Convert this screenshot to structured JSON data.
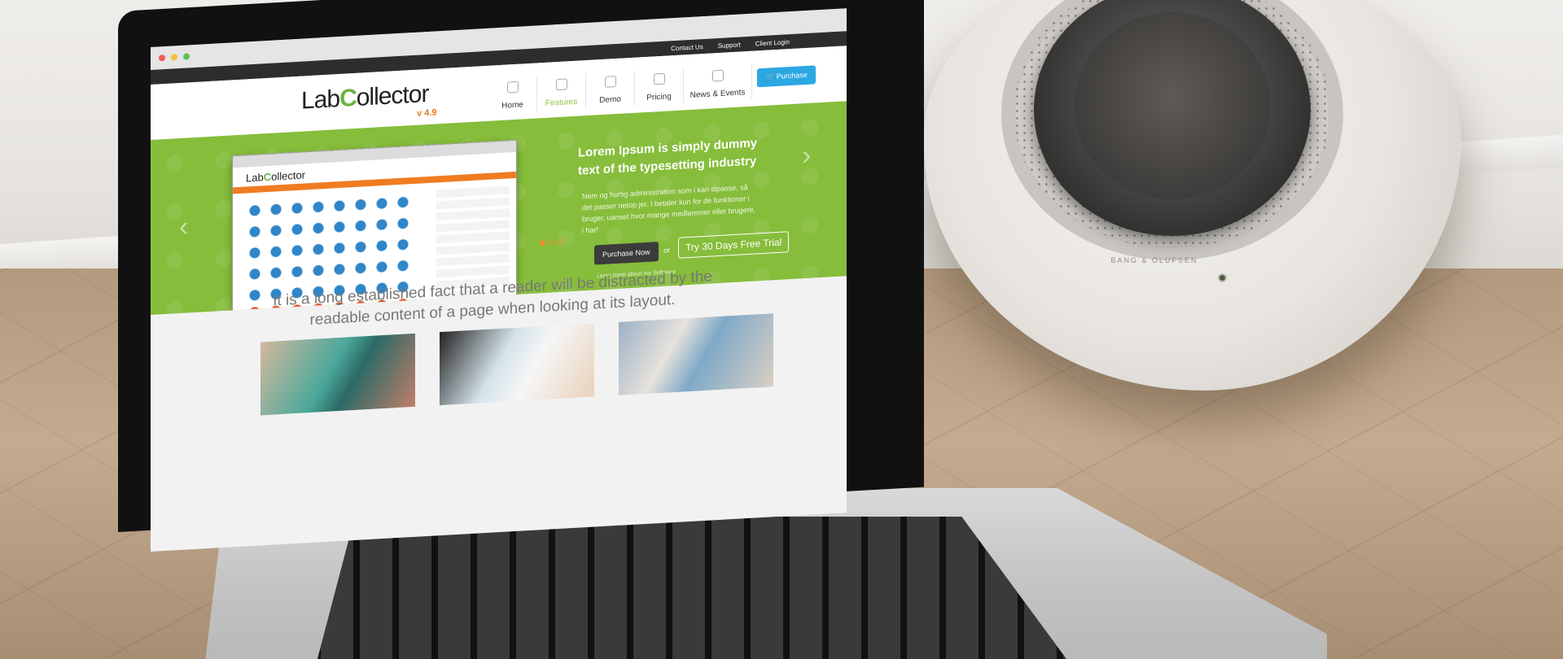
{
  "site": {
    "top_links": [
      "Contact Us",
      "Support",
      "Client Login"
    ],
    "logo_text_a": "Lab",
    "logo_text_c": "C",
    "logo_text_b": "ollector",
    "version": "v 4.9",
    "nav": [
      {
        "label": "Home",
        "icon": "home-icon"
      },
      {
        "label": "Features",
        "icon": "gear-icon"
      },
      {
        "label": "Demo",
        "icon": "monitor-icon"
      },
      {
        "label": "Pricing",
        "icon": "tag-icon"
      },
      {
        "label": "News & Events",
        "icon": "news-icon"
      }
    ],
    "purchase_label": "Purchase",
    "hero": {
      "title": "Lorem Ipsum is simply dummy text of the typesetting industry",
      "body": "Nem og hurtig administration som i kan tilpasse, så det passer netop jer. I betaler kun for de funktioner i bruger, uanset hvor mange medlemmer eller brugere, i har!",
      "primary_button": "Purchase Now",
      "or": "or",
      "secondary_button": "Try 30 Days Free Trial",
      "learn_more": "Learn more about our Software"
    },
    "tagline": "It is a long established fact that a reader will be distracted by the readable content of a page when looking at its layout.",
    "slide_count": 3,
    "active_slide": 1
  },
  "speaker": {
    "brand": "BANG & OLUFSEN"
  },
  "colors": {
    "accent_green": "#86bd3b",
    "orange": "#f08c2e",
    "blue_button": "#2ba7e3"
  }
}
